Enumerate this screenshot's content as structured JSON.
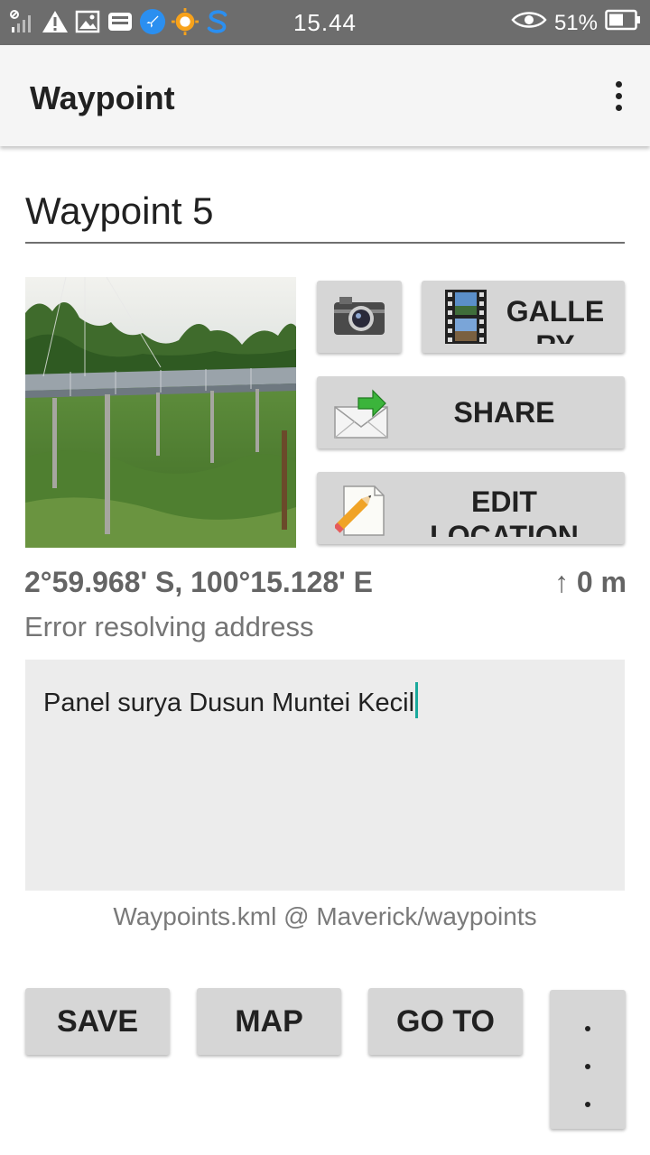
{
  "status_bar": {
    "time": "15.44",
    "battery": "51%",
    "icons": [
      "signal-icon",
      "warning-icon",
      "gallery-icon",
      "inbox-icon",
      "rocket-icon",
      "sun-icon",
      "s-app-icon",
      "eye-icon",
      "battery-icon"
    ]
  },
  "toolbar": {
    "title": "Waypoint",
    "overflow_icon": "more-vertical-icon"
  },
  "waypoint": {
    "name": "Waypoint 5",
    "coordinates": "2°59.968' S, 100°15.128' E",
    "altitude": "↑ 0 m",
    "address": "Error resolving address",
    "notes": "Panel surya Dusun Muntei Kecil",
    "file": "Waypoints.kml @ Maverick/waypoints"
  },
  "actions": {
    "camera_icon": "camera-icon",
    "gallery_label": "GALLERY",
    "share_label": "SHARE",
    "edit_label": "EDIT LOCATION"
  },
  "bottom_bar": {
    "save": "SAVE",
    "map": "MAP",
    "goto": "GO TO"
  },
  "colors": {
    "status_bar": "#6d6d6d",
    "toolbar": "#f5f5f5",
    "button": "#d6d6d6",
    "cursor": "#1aa99c"
  }
}
